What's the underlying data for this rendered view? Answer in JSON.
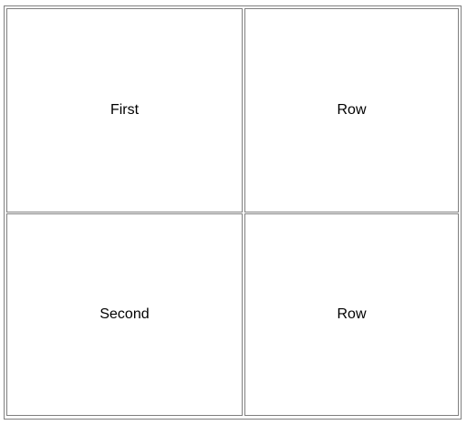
{
  "table": {
    "rows": [
      {
        "cells": [
          "First",
          "Row"
        ]
      },
      {
        "cells": [
          "Second",
          "Row"
        ]
      }
    ]
  },
  "colors": {
    "border": "#808080",
    "background": "#ffffff",
    "text": "#000000"
  }
}
